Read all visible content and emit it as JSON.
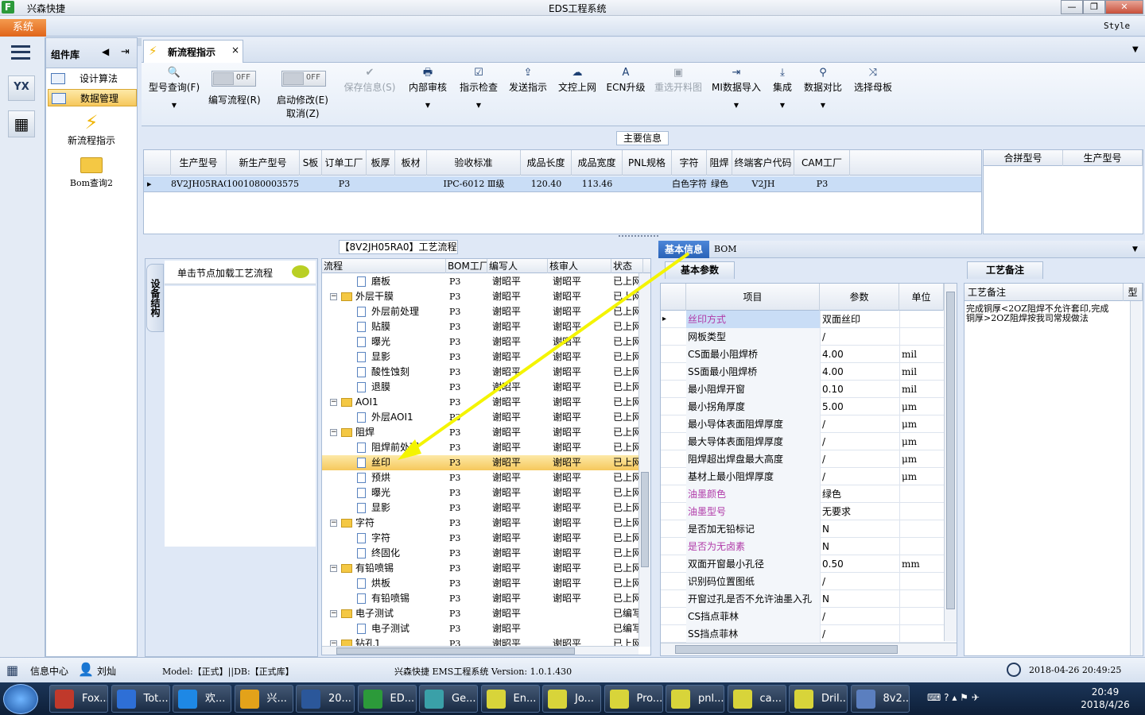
{
  "window": {
    "app_name": "兴森快捷",
    "title": "EDS工程系统",
    "style_label": "Style",
    "logo_letter": "F",
    "min": "—",
    "max": "❐",
    "close": "✕"
  },
  "menu": {
    "system": "系统"
  },
  "nav": {
    "header": "组件库",
    "items": [
      {
        "label": "设计算法"
      },
      {
        "label": "数据管理"
      }
    ],
    "big_items": [
      {
        "label": "新流程指示"
      },
      {
        "label": "Bom查询2"
      }
    ]
  },
  "tab": {
    "label": "新流程指示",
    "close": "×"
  },
  "toolbar": {
    "items": [
      {
        "label": "型号查询(F)",
        "icon": "🔍"
      },
      {
        "label": "编写流程(R)",
        "toggle": "OFF"
      },
      {
        "label": "启动修改(E)",
        "sub": "取消(Z)",
        "toggle": "OFF"
      },
      {
        "label": "保存信息(S)",
        "icon": "✔"
      },
      {
        "label": "内部审核",
        "icon": "🖶"
      },
      {
        "label": "指示检查",
        "icon": "☑"
      },
      {
        "label": "发送指示",
        "icon": "⇪"
      },
      {
        "label": "文控上网",
        "icon": "☁"
      },
      {
        "label": "ECN升级",
        "icon": "A"
      },
      {
        "label": "重选开料图",
        "icon": "▣"
      },
      {
        "label": "MI数据导入",
        "icon": "⇥"
      },
      {
        "label": "集成",
        "icon": "⤓"
      },
      {
        "label": "数据对比",
        "icon": "⚲"
      },
      {
        "label": "选择母板",
        "icon": "⤨"
      }
    ]
  },
  "main_info": {
    "title": "主要信息",
    "columns": [
      "生产型号",
      "新生产型号",
      "S板",
      "订单工厂",
      "板厚",
      "板材",
      "验收标准",
      "成品长度",
      "成品宽度",
      "PNL规格",
      "字符",
      "阻焊",
      "终端客户代码",
      "CAM工厂"
    ],
    "row": [
      "8V2JH05RA0",
      "10010800035757",
      "",
      "P3",
      "",
      "",
      "IPC-6012 Ⅲ级",
      "120.40",
      "113.46",
      "",
      "白色字符",
      "绿色",
      "V2JH",
      "P3"
    ],
    "side_columns": [
      "合拼型号",
      "生产型号"
    ]
  },
  "process": {
    "title": "【8V2JH05RA0】工艺流程",
    "side_tab": "设备结构",
    "load_hint": "单击节点加载工艺流程",
    "columns": [
      "流程",
      "BOM工厂",
      "编写人",
      "核审人",
      "状态"
    ],
    "rows": [
      {
        "name": "磨板",
        "lvl": 2,
        "f": "P3",
        "w": "谢昭平",
        "r": "谢昭平",
        "s": "已上网"
      },
      {
        "name": "外层干膜",
        "lvl": 1,
        "f": "P3",
        "w": "谢昭平",
        "r": "谢昭平",
        "s": "已上网"
      },
      {
        "name": "外层前处理",
        "lvl": 2,
        "f": "P3",
        "w": "谢昭平",
        "r": "谢昭平",
        "s": "已上网"
      },
      {
        "name": "贴膜",
        "lvl": 2,
        "f": "P3",
        "w": "谢昭平",
        "r": "谢昭平",
        "s": "已上网"
      },
      {
        "name": "曝光",
        "lvl": 2,
        "f": "P3",
        "w": "谢昭平",
        "r": "谢昭平",
        "s": "已上网"
      },
      {
        "name": "显影",
        "lvl": 2,
        "f": "P3",
        "w": "谢昭平",
        "r": "谢昭平",
        "s": "已上网"
      },
      {
        "name": "酸性蚀刻",
        "lvl": 2,
        "f": "P3",
        "w": "谢昭平",
        "r": "谢昭平",
        "s": "已上网"
      },
      {
        "name": "退膜",
        "lvl": 2,
        "f": "P3",
        "w": "谢昭平",
        "r": "谢昭平",
        "s": "已上网"
      },
      {
        "name": "AOI1",
        "lvl": 1,
        "f": "P3",
        "w": "谢昭平",
        "r": "谢昭平",
        "s": "已上网"
      },
      {
        "name": "外层AOI1",
        "lvl": 2,
        "f": "P3",
        "w": "谢昭平",
        "r": "谢昭平",
        "s": "已上网"
      },
      {
        "name": "阻焊",
        "lvl": 1,
        "f": "P3",
        "w": "谢昭平",
        "r": "谢昭平",
        "s": "已上网"
      },
      {
        "name": "阻焊前处理",
        "lvl": 2,
        "f": "P3",
        "w": "谢昭平",
        "r": "谢昭平",
        "s": "已上网"
      },
      {
        "name": "丝印",
        "lvl": 2,
        "f": "P3",
        "w": "谢昭平",
        "r": "谢昭平",
        "s": "已上网",
        "sel": true
      },
      {
        "name": "预烘",
        "lvl": 2,
        "f": "P3",
        "w": "谢昭平",
        "r": "谢昭平",
        "s": "已上网"
      },
      {
        "name": "曝光",
        "lvl": 2,
        "f": "P3",
        "w": "谢昭平",
        "r": "谢昭平",
        "s": "已上网"
      },
      {
        "name": "显影",
        "lvl": 2,
        "f": "P3",
        "w": "谢昭平",
        "r": "谢昭平",
        "s": "已上网"
      },
      {
        "name": "字符",
        "lvl": 1,
        "f": "P3",
        "w": "谢昭平",
        "r": "谢昭平",
        "s": "已上网"
      },
      {
        "name": "字符",
        "lvl": 2,
        "f": "P3",
        "w": "谢昭平",
        "r": "谢昭平",
        "s": "已上网"
      },
      {
        "name": "终固化",
        "lvl": 2,
        "f": "P3",
        "w": "谢昭平",
        "r": "谢昭平",
        "s": "已上网"
      },
      {
        "name": "有铅喷锡",
        "lvl": 1,
        "f": "P3",
        "w": "谢昭平",
        "r": "谢昭平",
        "s": "已上网"
      },
      {
        "name": "烘板",
        "lvl": 2,
        "f": "P3",
        "w": "谢昭平",
        "r": "谢昭平",
        "s": "已上网"
      },
      {
        "name": "有铅喷锡",
        "lvl": 2,
        "f": "P3",
        "w": "谢昭平",
        "r": "谢昭平",
        "s": "已上网"
      },
      {
        "name": "电子测试",
        "lvl": 1,
        "f": "P3",
        "w": "谢昭平",
        "r": "",
        "s": "已编写"
      },
      {
        "name": "电子测试",
        "lvl": 2,
        "f": "P3",
        "w": "谢昭平",
        "r": "",
        "s": "已编写"
      },
      {
        "name": "钻孔1",
        "lvl": 1,
        "f": "P3",
        "w": "谢昭平",
        "r": "谢昭平",
        "s": "已上网"
      }
    ]
  },
  "right": {
    "tabs": [
      "基本信息",
      "BOM"
    ],
    "sub_tab": "基本参数",
    "columns": [
      "项目",
      "参数",
      "单位"
    ],
    "rows": [
      {
        "k": "丝印方式",
        "v": "双面丝印",
        "u": "",
        "c": "#b03aa8",
        "sel": true
      },
      {
        "k": "网板类型",
        "v": "/",
        "u": ""
      },
      {
        "k": "CS面最小阻焊桥",
        "v": "4.00",
        "u": "mil"
      },
      {
        "k": "SS面最小阻焊桥",
        "v": "4.00",
        "u": "mil"
      },
      {
        "k": "最小阻焊开窗",
        "v": "0.10",
        "u": "mil"
      },
      {
        "k": "最小拐角厚度",
        "v": "5.00",
        "u": "μm"
      },
      {
        "k": "最小导体表面阻焊厚度",
        "v": "/",
        "u": "μm"
      },
      {
        "k": "最大导体表面阻焊厚度",
        "v": "/",
        "u": "μm"
      },
      {
        "k": "阻焊超出焊盘最大高度",
        "v": "/",
        "u": "μm"
      },
      {
        "k": "基材上最小阻焊厚度",
        "v": "/",
        "u": "μm"
      },
      {
        "k": "油墨颜色",
        "v": "绿色",
        "u": "",
        "c": "#b03aa8"
      },
      {
        "k": "油墨型号",
        "v": "无要求",
        "u": "",
        "c": "#b03aa8"
      },
      {
        "k": "是否加无铅标记",
        "v": "N",
        "u": ""
      },
      {
        "k": "是否为无卤素",
        "v": "N",
        "u": "",
        "c": "#b03aa8"
      },
      {
        "k": "双面开窗最小孔径",
        "v": "0.50",
        "u": "mm"
      },
      {
        "k": "识别码位置图纸",
        "v": "/",
        "u": ""
      },
      {
        "k": "开窗过孔是否不允许油墨入孔",
        "v": "N",
        "u": ""
      },
      {
        "k": "CS挡点菲林",
        "v": "/",
        "u": ""
      },
      {
        "k": "SS挡点菲林",
        "v": "/",
        "u": ""
      }
    ],
    "note_tab": "工艺备注",
    "note_columns": [
      "工艺备注",
      "型"
    ],
    "note_text": "完成铜厚<2OZ阻焊不允许套印,完成铜厚>2OZ阻焊按我司常规做法"
  },
  "status": {
    "info_center": "信息中心",
    "user": "刘灿",
    "model": "Model:【正式】||DB:【正式库】",
    "center": "兴森快捷  EMS工程系统  Version: 1.0.1.430",
    "datetime": "2018-04-26 20:49:25"
  },
  "taskbar": {
    "items": [
      {
        "label": "Fox...",
        "c": "#c0392b"
      },
      {
        "label": "Tot...",
        "c": "#2e6fd6"
      },
      {
        "label": "欢...",
        "c": "#1e88e5"
      },
      {
        "label": "兴...",
        "c": "#e3a21a"
      },
      {
        "label": "20...",
        "c": "#2b579a"
      },
      {
        "label": "ED...",
        "c": "#2c9a3a"
      },
      {
        "label": "Ge...",
        "c": "#3aa0a8"
      },
      {
        "label": "En...",
        "c": "#d8d43a"
      },
      {
        "label": "Jo...",
        "c": "#d8d43a"
      },
      {
        "label": "Pro...",
        "c": "#d8d43a"
      },
      {
        "label": "pnl...",
        "c": "#d8d43a"
      },
      {
        "label": "ca...",
        "c": "#d8d43a"
      },
      {
        "label": "Dril...",
        "c": "#d8d43a"
      },
      {
        "label": "8v2...",
        "c": "#5b7fbf"
      }
    ],
    "time": "20:49",
    "date": "2018/4/26"
  },
  "colors": {
    "accent": "#f6c85c",
    "selected_row": "#c9ddf6",
    "annotation_arrow": "#f4f400"
  }
}
